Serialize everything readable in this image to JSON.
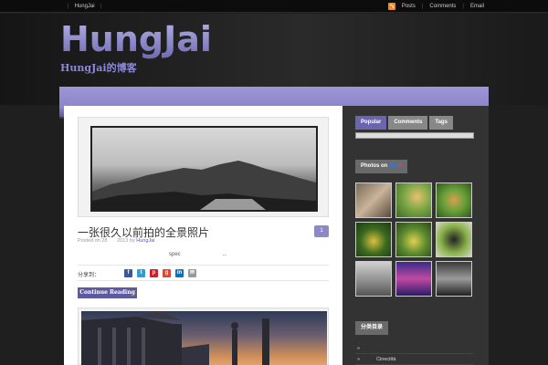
{
  "topbar": {
    "home_label": "HungJai",
    "links": [
      "Posts",
      "Comments",
      "Email"
    ]
  },
  "header": {
    "logo_text": "HungJai",
    "tagline": "HungJai的博客"
  },
  "post": {
    "title": "一张很久以前拍的全景照片",
    "meta_prefix": "Posted on 28",
    "meta_year": "2013 by",
    "author": "HungJai",
    "comment_count": "1",
    "excerpt_word": "spec",
    "excerpt_dots": "...",
    "share_label": "分享到：",
    "continue_label": "Continue Reading"
  },
  "share_icons": [
    {
      "name": "facebook-icon",
      "glyph": "f",
      "color": "#3b5998"
    },
    {
      "name": "twitter-icon",
      "glyph": "t",
      "color": "#2fa0d6"
    },
    {
      "name": "pinterest-icon",
      "glyph": "p",
      "color": "#c8232c"
    },
    {
      "name": "googleplus-icon",
      "glyph": "g",
      "color": "#d34836"
    },
    {
      "name": "linkedin-icon",
      "glyph": "in",
      "color": "#0a75b5"
    },
    {
      "name": "email-icon",
      "glyph": "✉",
      "color": "#9a9a9a"
    }
  ],
  "sidebar": {
    "tabs": [
      "Popular",
      "Comments",
      "Tags"
    ],
    "photos_prefix": "Photos on ",
    "flickr_blue": "flick",
    "flickr_pink": "r",
    "widget2_title": "分类目录",
    "list_items": [
      "",
      "Cinecittà"
    ]
  },
  "colors": {
    "accent": "#6b65b0",
    "nav": "#8a84c9"
  }
}
